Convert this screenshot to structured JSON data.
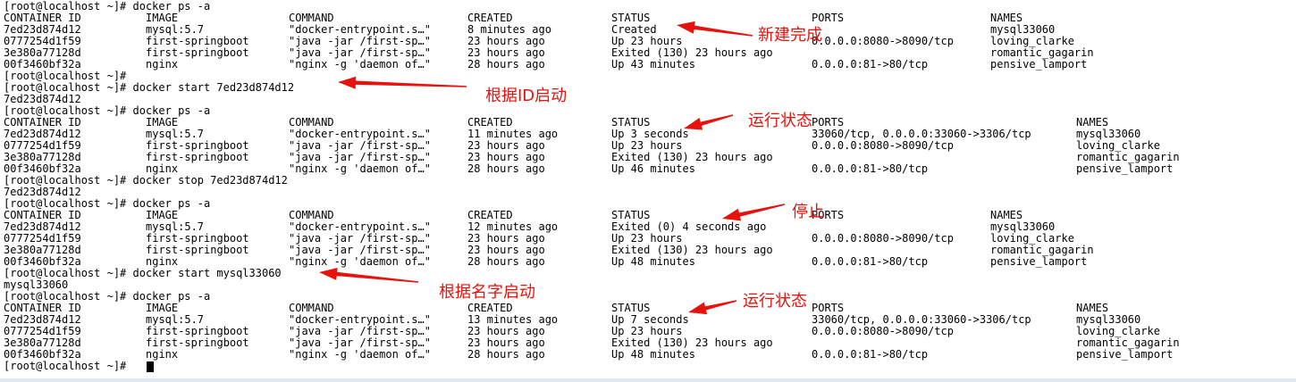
{
  "prompt": "[root@localhost ~]# ",
  "terminal_lines": [
    [
      "[root@localhost ~]# docker ps -a"
    ],
    [
      "CONTAINER ID",
      "IMAGE",
      "COMMAND",
      "CREATED",
      "STATUS",
      "PORTS",
      "NAMES"
    ],
    [
      "7ed23d874d12",
      "mysql:5.7",
      "\"docker-entrypoint.s…\"",
      "8 minutes ago",
      "Created",
      "",
      "mysql33060"
    ],
    [
      "0777254d1f59",
      "first-springboot",
      "\"java -jar /first-sp…\"",
      "23 hours ago",
      "Up 23 hours",
      "0.0.0.0:8080->8090/tcp",
      "loving_clarke"
    ],
    [
      "3e380a77128d",
      "first-springboot",
      "\"java -jar /first-sp…\"",
      "23 hours ago",
      "Exited (130) 23 hours ago",
      "",
      "romantic_gagarin"
    ],
    [
      "00f3460bf32a",
      "nginx",
      "\"nginx -g 'daemon of…\"",
      "28 hours ago",
      "Up 43 minutes",
      "0.0.0.0:81->80/tcp",
      "pensive_lamport"
    ],
    [
      "[root@localhost ~]#"
    ],
    [
      "[root@localhost ~]# docker start 7ed23d874d12"
    ],
    [
      "7ed23d874d12"
    ],
    [
      "[root@localhost ~]# docker ps -a"
    ],
    [
      "CONTAINER ID",
      "IMAGE",
      "COMMAND",
      "CREATED",
      "STATUS",
      "PORTS",
      "NAMES"
    ],
    [
      "7ed23d874d12",
      "mysql:5.7",
      "\"docker-entrypoint.s…\"",
      "11 minutes ago",
      "Up 3 seconds",
      "33060/tcp, 0.0.0.0:33060->3306/tcp",
      "mysql33060"
    ],
    [
      "0777254d1f59",
      "first-springboot",
      "\"java -jar /first-sp…\"",
      "23 hours ago",
      "Up 23 hours",
      "0.0.0.0:8080->8090/tcp",
      "loving_clarke"
    ],
    [
      "3e380a77128d",
      "first-springboot",
      "\"java -jar /first-sp…\"",
      "23 hours ago",
      "Exited (130) 23 hours ago",
      "",
      "romantic_gagarin"
    ],
    [
      "00f3460bf32a",
      "nginx",
      "\"nginx -g 'daemon of…\"",
      "28 hours ago",
      "Up 46 minutes",
      "0.0.0.0:81->80/tcp",
      "pensive_lamport"
    ],
    [
      "[root@localhost ~]# docker stop 7ed23d874d12"
    ],
    [
      "7ed23d874d12"
    ],
    [
      "[root@localhost ~]# docker ps -a"
    ],
    [
      "CONTAINER ID",
      "IMAGE",
      "COMMAND",
      "CREATED",
      "STATUS",
      "PORTS",
      "NAMES"
    ],
    [
      "7ed23d874d12",
      "mysql:5.7",
      "\"docker-entrypoint.s…\"",
      "12 minutes ago",
      "Exited (0) 4 seconds ago",
      "",
      "mysql33060"
    ],
    [
      "0777254d1f59",
      "first-springboot",
      "\"java -jar /first-sp…\"",
      "23 hours ago",
      "Up 23 hours",
      "0.0.0.0:8080->8090/tcp",
      "loving_clarke"
    ],
    [
      "3e380a77128d",
      "first-springboot",
      "\"java -jar /first-sp…\"",
      "23 hours ago",
      "Exited (130) 23 hours ago",
      "",
      "romantic_gagarin"
    ],
    [
      "00f3460bf32a",
      "nginx",
      "\"nginx -g 'daemon of…\"",
      "28 hours ago",
      "Up 48 minutes",
      "0.0.0.0:81->80/tcp",
      "pensive_lamport"
    ],
    [
      "[root@localhost ~]# docker start mysql33060"
    ],
    [
      "mysql33060"
    ],
    [
      "[root@localhost ~]# docker ps -a"
    ],
    [
      "CONTAINER ID",
      "IMAGE",
      "COMMAND",
      "CREATED",
      "STATUS",
      "PORTS",
      "NAMES"
    ],
    [
      "7ed23d874d12",
      "mysql:5.7",
      "\"docker-entrypoint.s…\"",
      "13 minutes ago",
      "Up 7 seconds",
      "33060/tcp, 0.0.0.0:33060->3306/tcp",
      "mysql33060"
    ],
    [
      "0777254d1f59",
      "first-springboot",
      "\"java -jar /first-sp…\"",
      "23 hours ago",
      "Up 23 hours",
      "0.0.0.0:8080->8090/tcp",
      "loving_clarke"
    ],
    [
      "3e380a77128d",
      "first-springboot",
      "\"java -jar /first-sp…\"",
      "23 hours ago",
      "Exited (130) 23 hours ago",
      "",
      "romantic_gagarin"
    ],
    [
      "00f3460bf32a",
      "nginx",
      "\"nginx -g 'daemon of…\"",
      "28 hours ago",
      "Up 48 minutes",
      "0.0.0.0:81->80/tcp",
      "pensive_lamport"
    ],
    [
      "[root@localhost ~]#"
    ]
  ],
  "annotations": [
    {
      "text": "新建完成",
      "color": "#e8120c"
    },
    {
      "text": "根据ID启动",
      "color": "#e8120c"
    },
    {
      "text": "运行状态",
      "color": "#e8120c"
    },
    {
      "text": "停止",
      "color": "#e8120c"
    },
    {
      "text": "根据名字启动",
      "color": "#e8120c"
    },
    {
      "text": "运行状态",
      "color": "#e8120c"
    }
  ],
  "terminal_colors": {
    "background": "#ffffff",
    "foreground": "#000000"
  }
}
